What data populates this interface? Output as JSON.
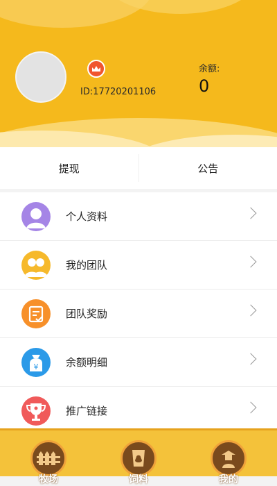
{
  "profile": {
    "user_id": "ID:17720201106",
    "balance_label": "余额:",
    "balance_value": "0"
  },
  "tabs": [
    {
      "label": "提现"
    },
    {
      "label": "公告"
    }
  ],
  "menu": [
    {
      "label": "个人资料",
      "icon": "person-icon",
      "color": "#a585e6"
    },
    {
      "label": "我的团队",
      "icon": "team-icon",
      "color": "#f6b92b"
    },
    {
      "label": "团队奖励",
      "icon": "reward-icon",
      "color": "#f7902a"
    },
    {
      "label": "余额明细",
      "icon": "money-bag-icon",
      "color": "#2b9ae8"
    },
    {
      "label": "推广链接",
      "icon": "trophy-icon",
      "color": "#f05a5a"
    }
  ],
  "bottom_nav": [
    {
      "label": "牧场",
      "icon": "fence-icon"
    },
    {
      "label": "饲料",
      "icon": "feed-bag-icon"
    },
    {
      "label": "我的",
      "icon": "farmer-icon"
    }
  ],
  "colors": {
    "header_bg": "#f5b91c",
    "nav_bg": "#f4c23a",
    "nav_icon_bg": "#7a4a1d"
  }
}
